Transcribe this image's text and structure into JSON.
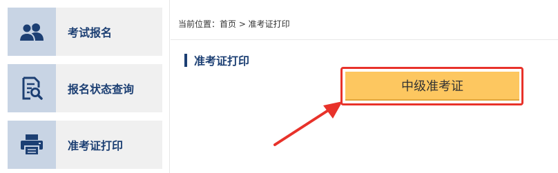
{
  "sidebar": {
    "items": [
      {
        "label": "考试报名",
        "icon": "users-icon"
      },
      {
        "label": "报名状态查询",
        "icon": "document-search-icon"
      },
      {
        "label": "准考证打印",
        "icon": "printer-icon"
      }
    ]
  },
  "breadcrumb": {
    "text": "当前位置：首页 > 准考证打印"
  },
  "section": {
    "title": "准考证打印"
  },
  "cert_button": {
    "label": "中级准考证"
  },
  "colors": {
    "primary": "#1c3f73",
    "sidebar_bg": "#f0f0f0",
    "icon_bg": "#c8d4e4",
    "button_bg": "#fdc760",
    "highlight": "#e8322a"
  }
}
